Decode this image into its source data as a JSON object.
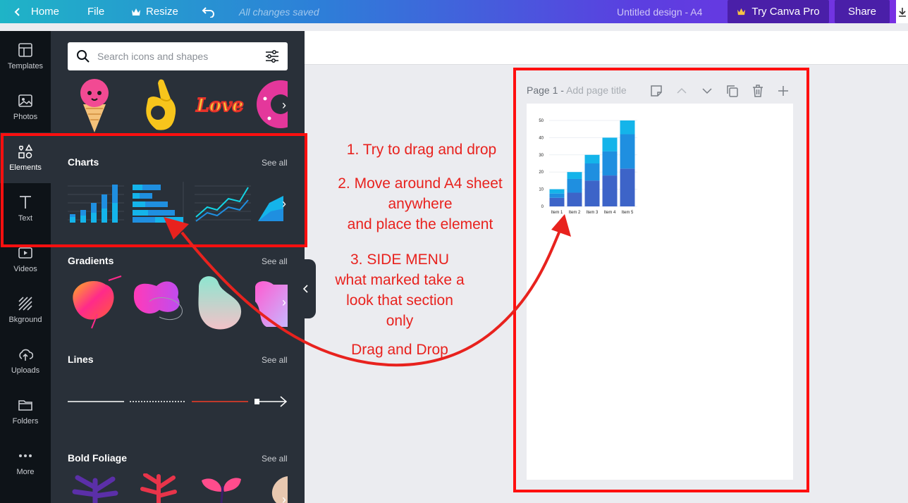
{
  "topbar": {
    "home": "Home",
    "file": "File",
    "resize": "Resize",
    "saved": "All changes saved",
    "design_title": "Untitled design - A4",
    "try_pro": "Try Canva Pro",
    "share": "Share"
  },
  "rail": {
    "items": [
      {
        "label": "Templates",
        "icon": "templates-icon"
      },
      {
        "label": "Photos",
        "icon": "photos-icon"
      },
      {
        "label": "Elements",
        "icon": "elements-icon",
        "active": true
      },
      {
        "label": "Text",
        "icon": "text-icon"
      },
      {
        "label": "Videos",
        "icon": "videos-icon"
      },
      {
        "label": "Bkground",
        "icon": "background-icon"
      },
      {
        "label": "Uploads",
        "icon": "uploads-icon"
      },
      {
        "label": "Folders",
        "icon": "folders-icon"
      },
      {
        "label": "More",
        "icon": "more-icon"
      }
    ]
  },
  "panel": {
    "search_placeholder": "Search icons and shapes",
    "sections": [
      {
        "title": "Charts",
        "see_all": "See all"
      },
      {
        "title": "Gradients",
        "see_all": "See all"
      },
      {
        "title": "Lines",
        "see_all": "See all"
      },
      {
        "title": "Bold Foliage",
        "see_all": "See all"
      }
    ],
    "sticker_text": "Love"
  },
  "page": {
    "label": "Page 1 -",
    "add_title": "Add page title"
  },
  "chart_data": {
    "type": "bar",
    "stacked": true,
    "categories": [
      "Item 1",
      "Item 2",
      "Item 3",
      "Item 4",
      "Item 5"
    ],
    "series": [
      {
        "values": [
          5,
          8,
          15,
          18,
          22
        ],
        "color": "#3d64c8"
      },
      {
        "values": [
          2.5,
          8,
          10,
          14,
          20
        ],
        "color": "#1f8fe0"
      },
      {
        "values": [
          2.5,
          4,
          5,
          8,
          8
        ],
        "color": "#14b4ea"
      }
    ],
    "ylim": [
      0,
      50
    ],
    "yticks": [
      0,
      10,
      20,
      30,
      40,
      50
    ]
  },
  "annotations": {
    "step1": "1. Try to drag and drop",
    "step2_line1": "2.  Move around A4 sheet",
    "step2_line2": "anywhere",
    "step2_line3": "and place the element",
    "step3_line1": "3. SIDE MENU",
    "step3_line2": "what marked take a",
    "step3_line3": "look that section",
    "step3_line4": "only",
    "drag_drop": "Drag and Drop",
    "color": "#e8221e"
  }
}
